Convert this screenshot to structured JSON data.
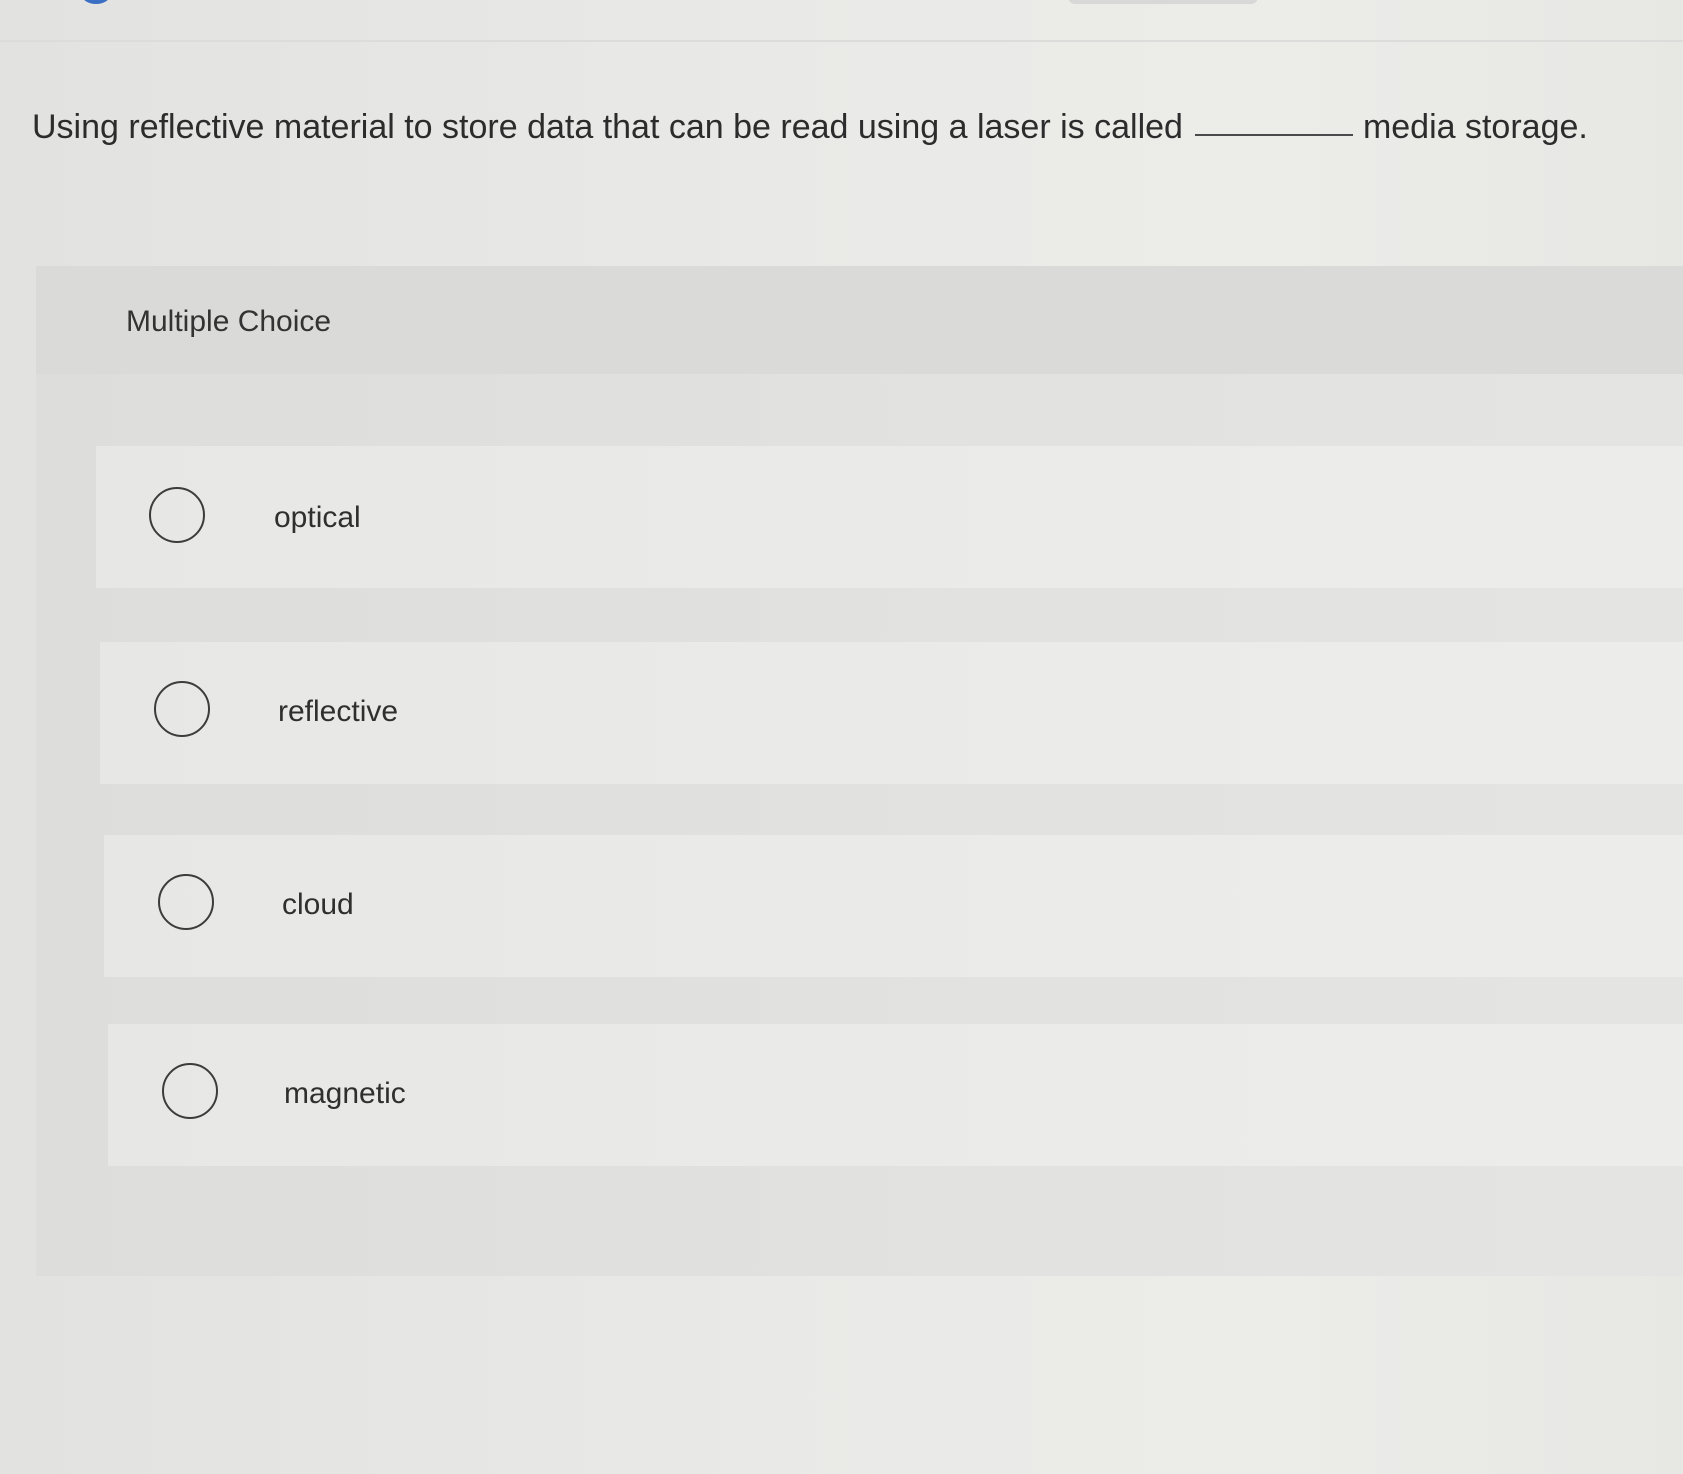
{
  "question": {
    "text_before": "Using reflective material to store data that can be read using a laser is called",
    "text_after": "media storage."
  },
  "answer_section": {
    "type_label": "Multiple Choice",
    "options": [
      {
        "label": "optical"
      },
      {
        "label": "reflective"
      },
      {
        "label": "cloud"
      },
      {
        "label": "magnetic"
      }
    ],
    "selected": null
  }
}
